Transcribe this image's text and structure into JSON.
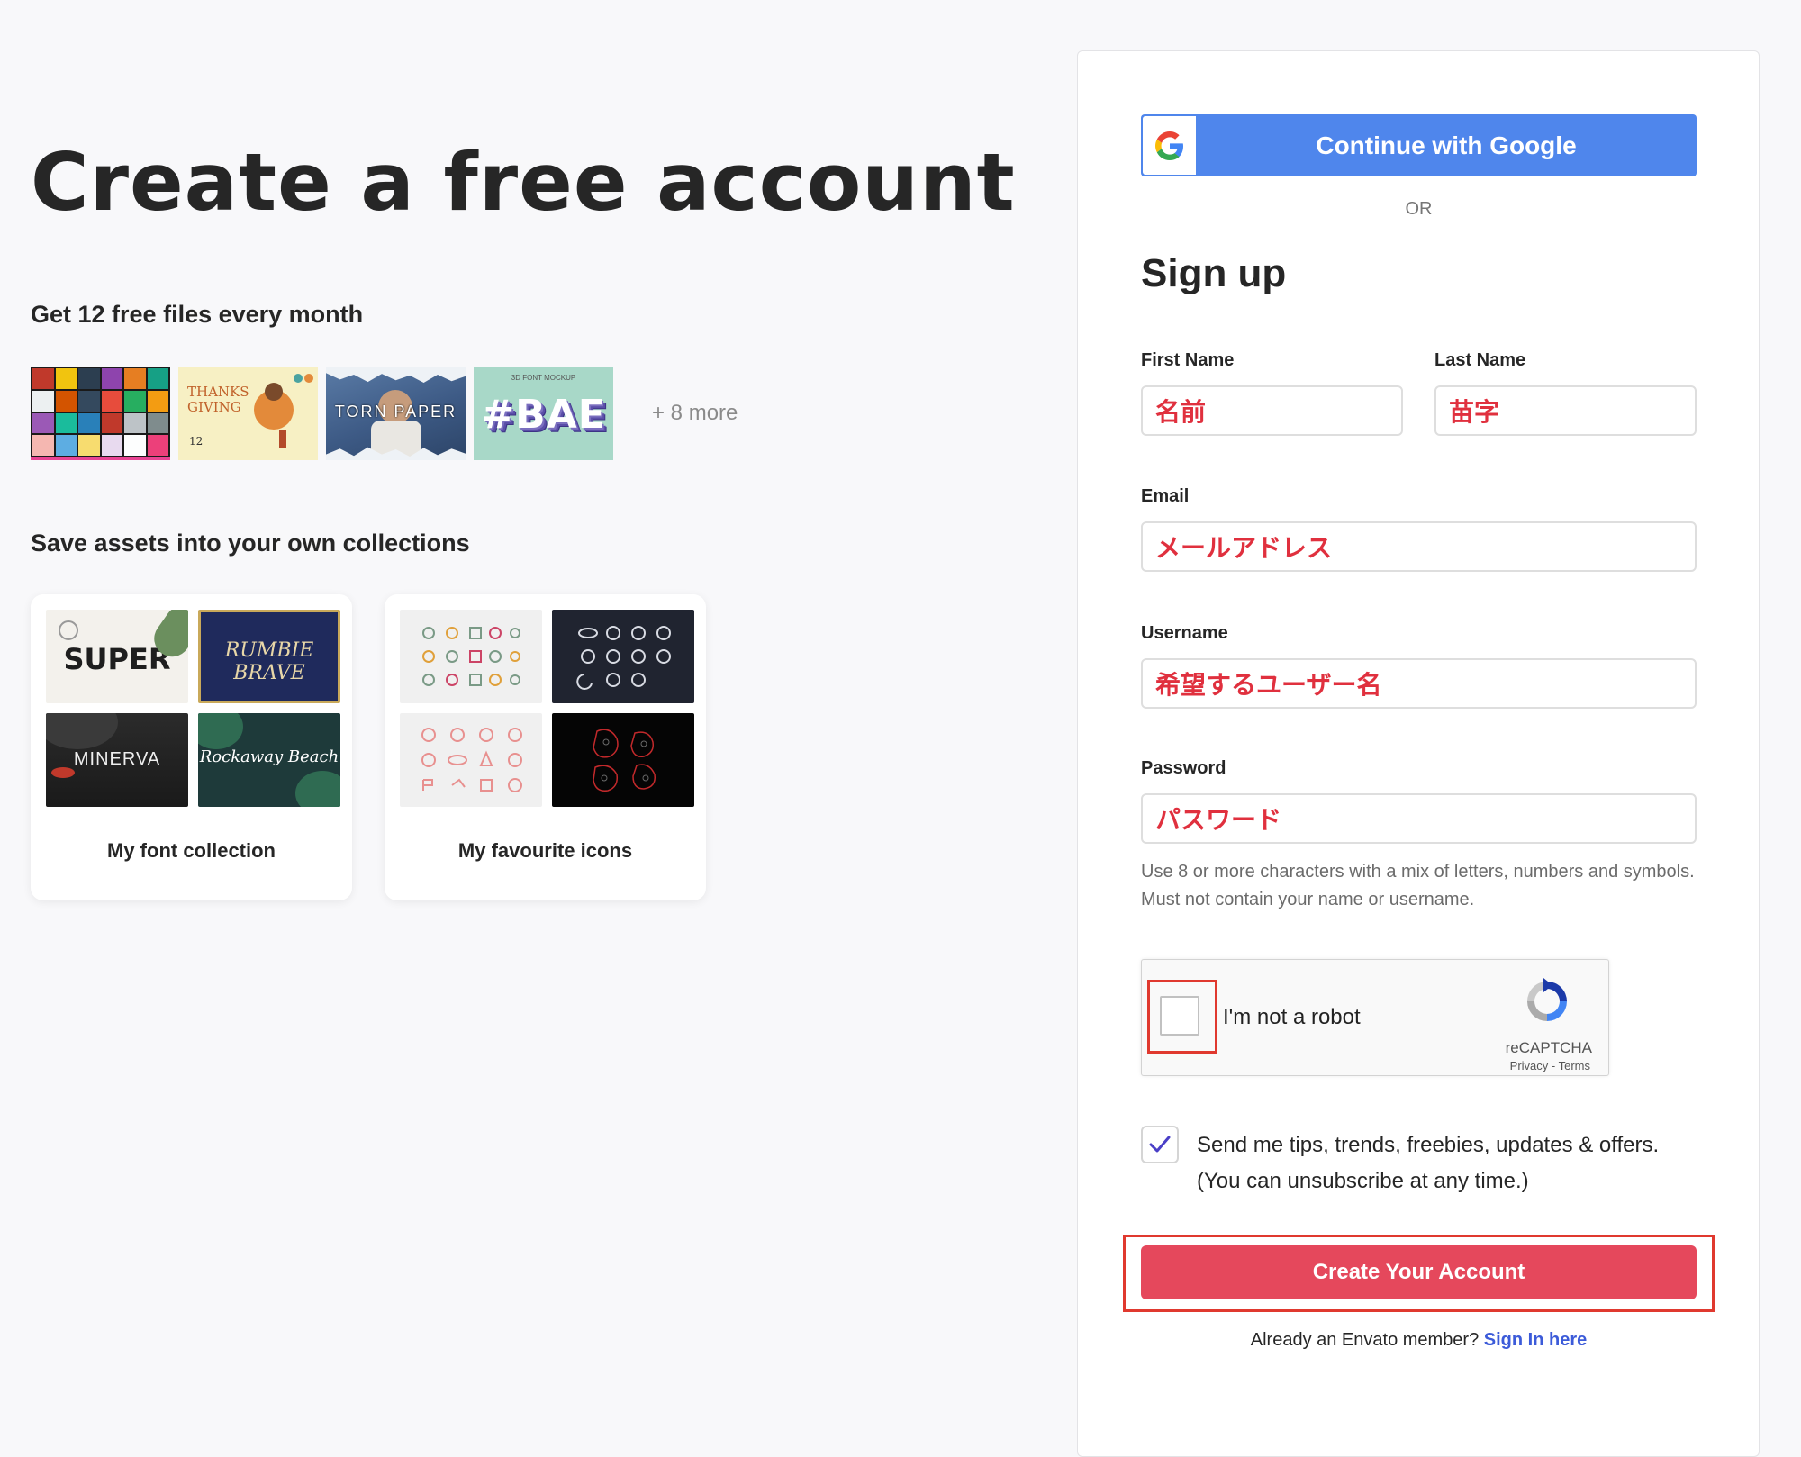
{
  "left": {
    "headline": "Create a free account",
    "free_files_heading": "Get 12 free files every month",
    "more_label": "+ 8 more",
    "collections_heading": "Save assets into your own collections",
    "thumbnails": {
      "t2_line1": "THANKS",
      "t2_line2": "GIVING",
      "t2_small": "12",
      "t3_text": "TORN PAPER",
      "t4_small": "3D FONT MOCKUP",
      "t4_text": "#BAE"
    },
    "collections": [
      {
        "title": "My font collection",
        "tiles": [
          "SUPER",
          "RUMBIE BRAVE",
          "MINERVA",
          "Rockaway Beach"
        ]
      },
      {
        "title": "My favourite icons"
      }
    ]
  },
  "form": {
    "google_label": "Continue with Google",
    "or_label": "OR",
    "title": "Sign up",
    "first_name_label": "First Name",
    "first_name_value": "名前",
    "last_name_label": "Last Name",
    "last_name_value": "苗字",
    "email_label": "Email",
    "email_value": "メールアドレス",
    "username_label": "Username",
    "username_value": "希望するユーザー名",
    "password_label": "Password",
    "password_value": "パスワード",
    "password_hint": "Use 8 or more characters with a mix of letters, numbers and symbols. Must not contain your name or username.",
    "recaptcha_label": "I'm not a robot",
    "recaptcha_brand": "reCAPTCHA",
    "recaptcha_links": "Privacy - Terms",
    "newsletter_checked": true,
    "newsletter_line1": "Send me tips, trends, freebies, updates & offers.",
    "newsletter_line2": "(You can unsubscribe at any time.)",
    "submit_label": "Create Your Account",
    "already_member": "Already an Envato member?",
    "signin_link": "Sign In here"
  },
  "colors": {
    "accent_red": "#e5485c",
    "google_blue": "#4f86ec",
    "link_blue": "#3c5bd9",
    "annotation_red": "#e0392f",
    "input_text_red": "#e0303e"
  }
}
